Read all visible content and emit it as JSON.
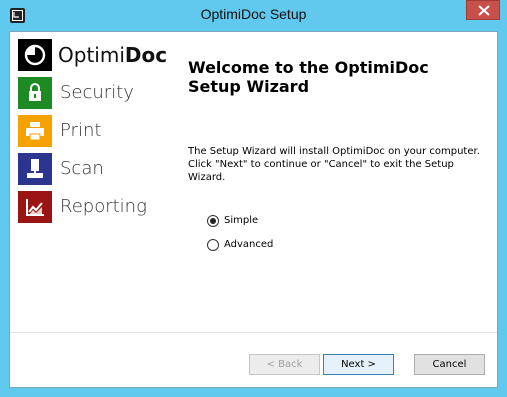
{
  "window": {
    "title": "OptimiDoc Setup"
  },
  "brand": {
    "logo": {
      "light": "Optimi",
      "bold": "Doc"
    },
    "items": [
      {
        "label": "Security",
        "icon": "lock-icon",
        "color": "#1e8a24"
      },
      {
        "label": "Print",
        "icon": "printer-icon",
        "color": "#f5a100"
      },
      {
        "label": "Scan",
        "icon": "scanner-icon",
        "color": "#2b3590"
      },
      {
        "label": "Reporting",
        "icon": "chart-icon",
        "color": "#9b1414"
      }
    ]
  },
  "content": {
    "heading_line1": "Welcome to the OptimiDoc",
    "heading_line2": "Setup Wizard",
    "desc_line1": "The Setup Wizard will install OptimiDoc on your computer.",
    "desc_line2": "Click \"Next\" to continue or \"Cancel\" to exit the Setup Wizard."
  },
  "options": {
    "selected": "Simple",
    "items": [
      {
        "label": "Simple",
        "checked": true
      },
      {
        "label": "Advanced",
        "checked": false
      }
    ]
  },
  "buttons": {
    "back": "< Back",
    "next": "Next >",
    "cancel": "Cancel"
  }
}
